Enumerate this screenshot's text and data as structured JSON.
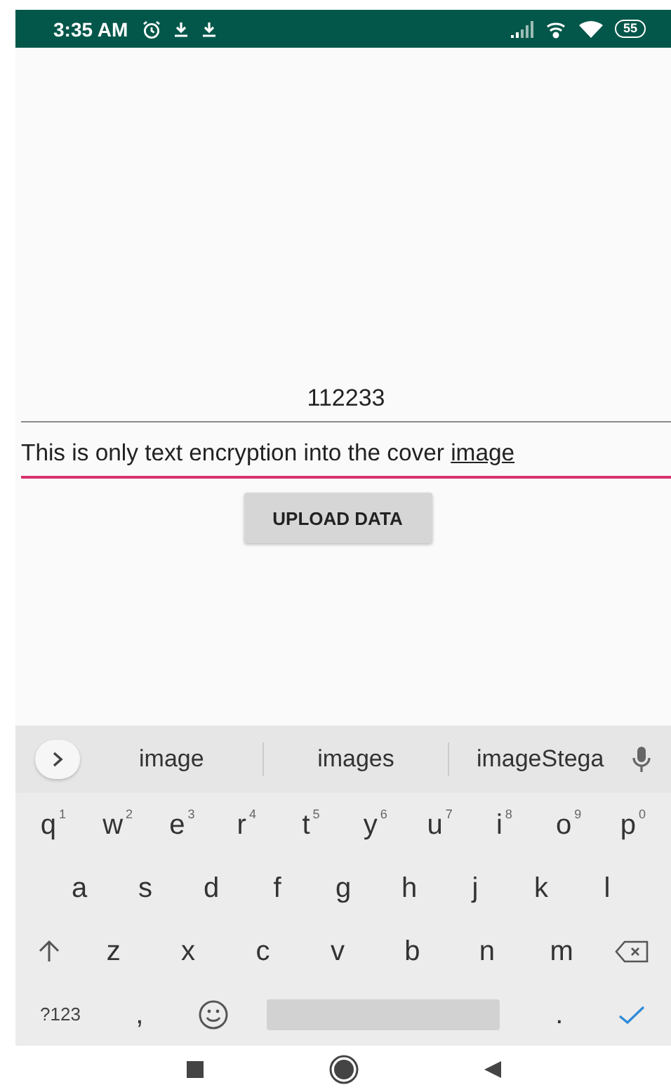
{
  "status_bar": {
    "time": "3:35 AM",
    "battery": "55"
  },
  "pin_field": {
    "value": "112233"
  },
  "message_field": {
    "value": "This is only text encryption into the cover ",
    "composing": "image",
    "focused": true
  },
  "upload_button": {
    "label": "UPLOAD DATA"
  },
  "keyboard": {
    "suggestions": [
      "image",
      "images",
      "imageStega"
    ],
    "rows": [
      [
        {
          "kind": "letter",
          "label": "q",
          "hint": "1"
        },
        {
          "kind": "letter",
          "label": "w",
          "hint": "2"
        },
        {
          "kind": "letter",
          "label": "e",
          "hint": "3"
        },
        {
          "kind": "letter",
          "label": "r",
          "hint": "4"
        },
        {
          "kind": "letter",
          "label": "t",
          "hint": "5"
        },
        {
          "kind": "letter",
          "label": "y",
          "hint": "6"
        },
        {
          "kind": "letter",
          "label": "u",
          "hint": "7"
        },
        {
          "kind": "letter",
          "label": "i",
          "hint": "8"
        },
        {
          "kind": "letter",
          "label": "o",
          "hint": "9"
        },
        {
          "kind": "letter",
          "label": "p",
          "hint": "0"
        }
      ],
      [
        {
          "kind": "letter",
          "label": "a"
        },
        {
          "kind": "letter",
          "label": "s"
        },
        {
          "kind": "letter",
          "label": "d"
        },
        {
          "kind": "letter",
          "label": "f"
        },
        {
          "kind": "letter",
          "label": "g"
        },
        {
          "kind": "letter",
          "label": "h"
        },
        {
          "kind": "letter",
          "label": "j"
        },
        {
          "kind": "letter",
          "label": "k"
        },
        {
          "kind": "letter",
          "label": "l"
        }
      ],
      [
        {
          "kind": "shift"
        },
        {
          "kind": "letter",
          "label": "z"
        },
        {
          "kind": "letter",
          "label": "x"
        },
        {
          "kind": "letter",
          "label": "c"
        },
        {
          "kind": "letter",
          "label": "v"
        },
        {
          "kind": "letter",
          "label": "b"
        },
        {
          "kind": "letter",
          "label": "n"
        },
        {
          "kind": "letter",
          "label": "m"
        },
        {
          "kind": "backspace"
        }
      ],
      [
        {
          "kind": "symbols",
          "label": "?123"
        },
        {
          "kind": "letter",
          "label": ","
        },
        {
          "kind": "emoji"
        },
        {
          "kind": "space"
        },
        {
          "kind": "letter",
          "label": "."
        },
        {
          "kind": "enter"
        }
      ]
    ]
  }
}
